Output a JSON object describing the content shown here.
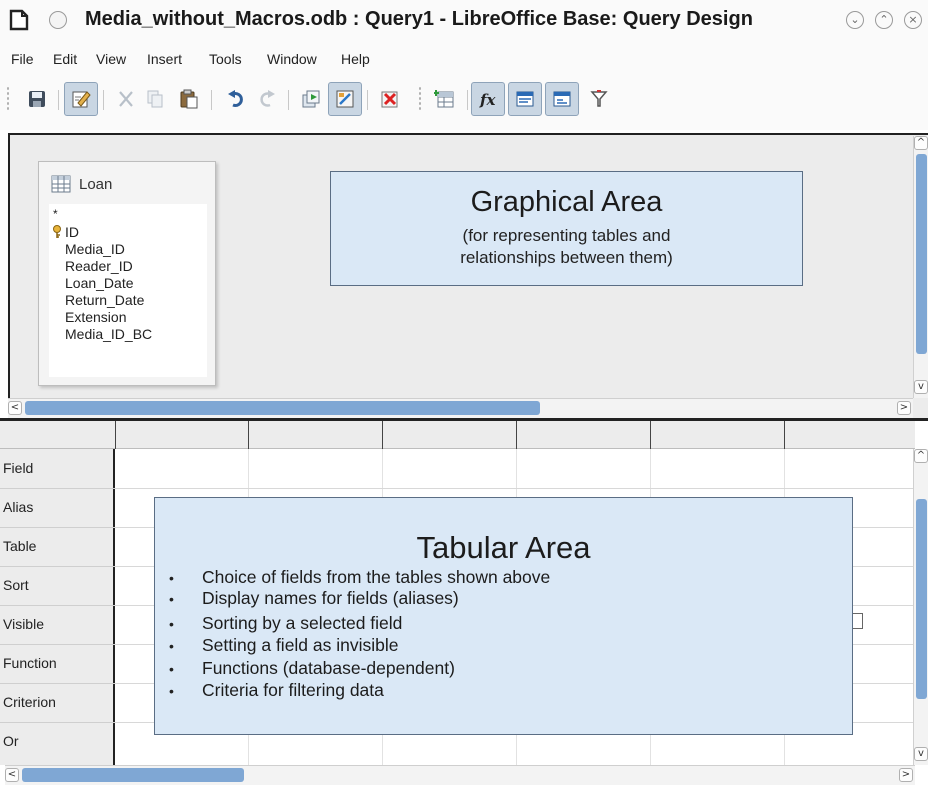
{
  "window": {
    "title": "Media_without_Macros.odb : Query1 - LibreOffice Base: Query Design",
    "controls": [
      "⌄",
      "⌃",
      "×"
    ]
  },
  "menu": {
    "items": [
      "File",
      "Edit",
      "View",
      "Insert",
      "Tools",
      "Window",
      "Help"
    ]
  },
  "toolbar": {
    "buttons": [
      {
        "name": "save-icon",
        "active": false
      },
      {
        "name": "edit-design-icon",
        "active": true
      },
      {
        "name": "cut-icon",
        "active": false
      },
      {
        "name": "copy-icon",
        "active": false
      },
      {
        "name": "paste-icon",
        "active": false
      },
      {
        "name": "undo-icon",
        "active": false
      },
      {
        "name": "redo-icon",
        "active": false
      },
      {
        "name": "run-query-icon",
        "active": false
      },
      {
        "name": "toggle-design-view-icon",
        "active": true
      },
      {
        "name": "clear-query-icon",
        "active": false
      },
      {
        "name": "add-table-icon",
        "active": false
      },
      {
        "name": "functions-icon",
        "active": true
      },
      {
        "name": "table-name-icon",
        "active": true
      },
      {
        "name": "alias-icon",
        "active": true
      },
      {
        "name": "distinct-values-icon",
        "active": false
      }
    ]
  },
  "graphical": {
    "table": {
      "name": "Loan",
      "fields": [
        "*",
        "ID",
        "Media_ID",
        "Reader_ID",
        "Loan_Date",
        "Return_Date",
        "Extension",
        "Media_ID_BC"
      ]
    },
    "note": {
      "title": "Graphical Area",
      "line1": "(for representing tables and",
      "line2": "relationships between them)"
    }
  },
  "tabular": {
    "row_labels": [
      "Field",
      "Alias",
      "Table",
      "Sort",
      "Visible",
      "Function",
      "Criterion",
      "Or"
    ],
    "note": {
      "title": "Tabular Area",
      "bullets": [
        "Choice of fields from the tables shown above",
        "Display names for fields (aliases)",
        "Sorting by a selected field",
        "Setting a field as invisible",
        "Functions (database-dependent)",
        "Criteria for filtering data"
      ],
      "bullet_char": "•"
    }
  },
  "scroll": {
    "left_arrow": "<",
    "right_arrow": ">",
    "up_arrow": "^",
    "down_arrow": "v",
    "grip": "III"
  },
  "colors": {
    "note_fill": "#dae8f6",
    "scroll_thumb": "#7fa7d4",
    "panel_bg": "#ececec"
  }
}
